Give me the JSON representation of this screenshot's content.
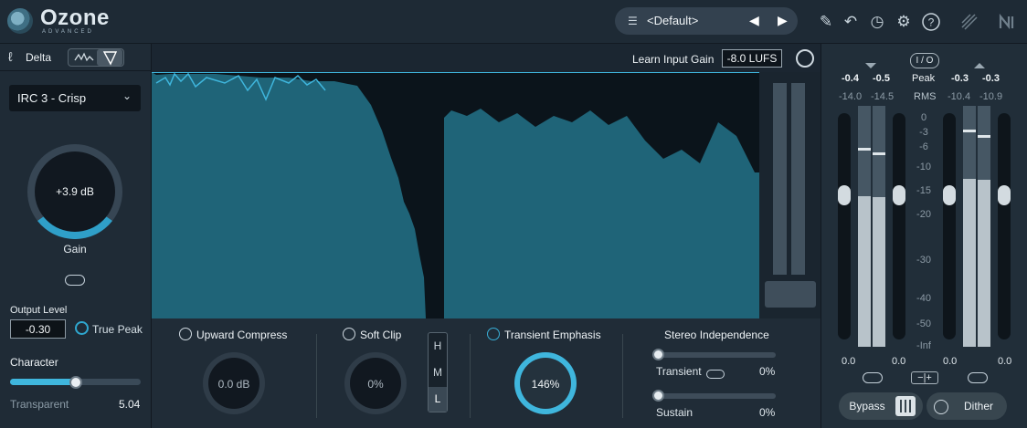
{
  "app": {
    "name": "Ozone",
    "edition": "ADVANCED"
  },
  "preset": {
    "name": "<Default>"
  },
  "toolbar": {
    "icons": [
      "pencil-icon",
      "undo-icon",
      "history-icon",
      "gear-icon",
      "help-icon",
      "izotope-logo-icon",
      "ni-logo-icon"
    ]
  },
  "delta": {
    "label": "Delta"
  },
  "learn": {
    "label": "Learn Input Gain",
    "value": "-8.0 LUFS"
  },
  "left": {
    "mode": "IRC 3 - Crisp",
    "gain_value": "+3.9 dB",
    "gain_label": "Gain",
    "output_label": "Output Level",
    "output_value": "-0.30",
    "true_peak": "True Peak",
    "character_label": "Character",
    "character_left": "Transparent",
    "character_value": "5.04",
    "character_fraction": 0.5
  },
  "modules": {
    "upward": {
      "title": "Upward Compress",
      "value": "0.0 dB"
    },
    "softclip": {
      "title": "Soft Clip",
      "value": "0%"
    },
    "hml": [
      "H",
      "M",
      "L"
    ],
    "transient": {
      "title": "Transient Emphasis",
      "value": "146%"
    },
    "stereo": {
      "title": "Stereo Independence",
      "transient_label": "Transient",
      "transient_value": "0%",
      "sustain_label": "Sustain",
      "sustain_value": "0%"
    }
  },
  "meters": {
    "io_label": "I / O",
    "peak_label": "Peak",
    "rms_label": "RMS",
    "in_peak": [
      "-0.4",
      "-0.5"
    ],
    "in_rms": [
      "-14.0",
      "-14.5"
    ],
    "out_peak": [
      "-0.3",
      "-0.3"
    ],
    "out_rms": [
      "-10.4",
      "-10.9"
    ],
    "scale": [
      "0",
      "-3",
      "-6",
      "-10",
      "-15",
      "-20",
      "-30",
      "-40",
      "-50",
      "-Inf"
    ],
    "in_gain": [
      "0.0",
      "0.0"
    ],
    "out_gain": [
      "0.0",
      "0.0"
    ],
    "bypass": "Bypass",
    "dither": "Dither"
  },
  "colors": {
    "accent": "#3fb6dd",
    "spectrum": "#1f6478",
    "spectrum_line": "#3fb6dd"
  }
}
